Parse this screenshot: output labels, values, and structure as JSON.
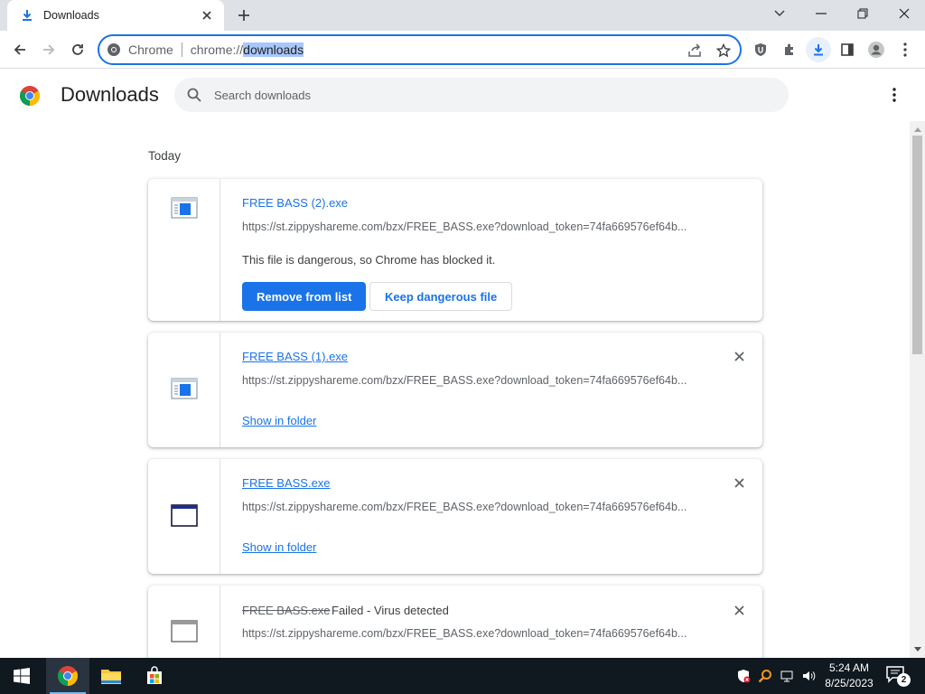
{
  "browser": {
    "tab": {
      "title": "Downloads",
      "icon": "download-icon"
    },
    "omnibox": {
      "chip_label": "Chrome",
      "url_prefix": "chrome://",
      "url_selected": "downloads"
    }
  },
  "page": {
    "title": "Downloads",
    "search": {
      "placeholder": "Search downloads"
    },
    "section_date": "Today"
  },
  "downloads": [
    {
      "filename": "FREE BASS (2).exe",
      "url": "https://st.zippyshareme.com/bzx/FREE_BASS.exe?download_token=74fa669576ef64b...",
      "message": "This file is dangerous, so Chrome has blocked it.",
      "remove_label": "Remove from list",
      "keep_label": "Keep dangerous file"
    },
    {
      "filename": "FREE BASS (1).exe",
      "url": "https://st.zippyshareme.com/bzx/FREE_BASS.exe?download_token=74fa669576ef64b...",
      "show_in_folder_label": "Show in folder"
    },
    {
      "filename": "FREE BASS.exe",
      "url": "https://st.zippyshareme.com/bzx/FREE_BASS.exe?download_token=74fa669576ef64b...",
      "show_in_folder_label": "Show in folder"
    },
    {
      "filename": "FREE BASS.exe",
      "status": "Failed - Virus detected",
      "url": "https://st.zippyshareme.com/bzx/FREE_BASS.exe?download_token=74fa669576ef64b..."
    }
  ],
  "taskbar": {
    "time": "5:24 AM",
    "date": "8/25/2023",
    "notification_count": "2"
  },
  "colors": {
    "accent": "#1a73e8",
    "taskbar": "#101820",
    "tabstrip": "#dee1e6"
  }
}
